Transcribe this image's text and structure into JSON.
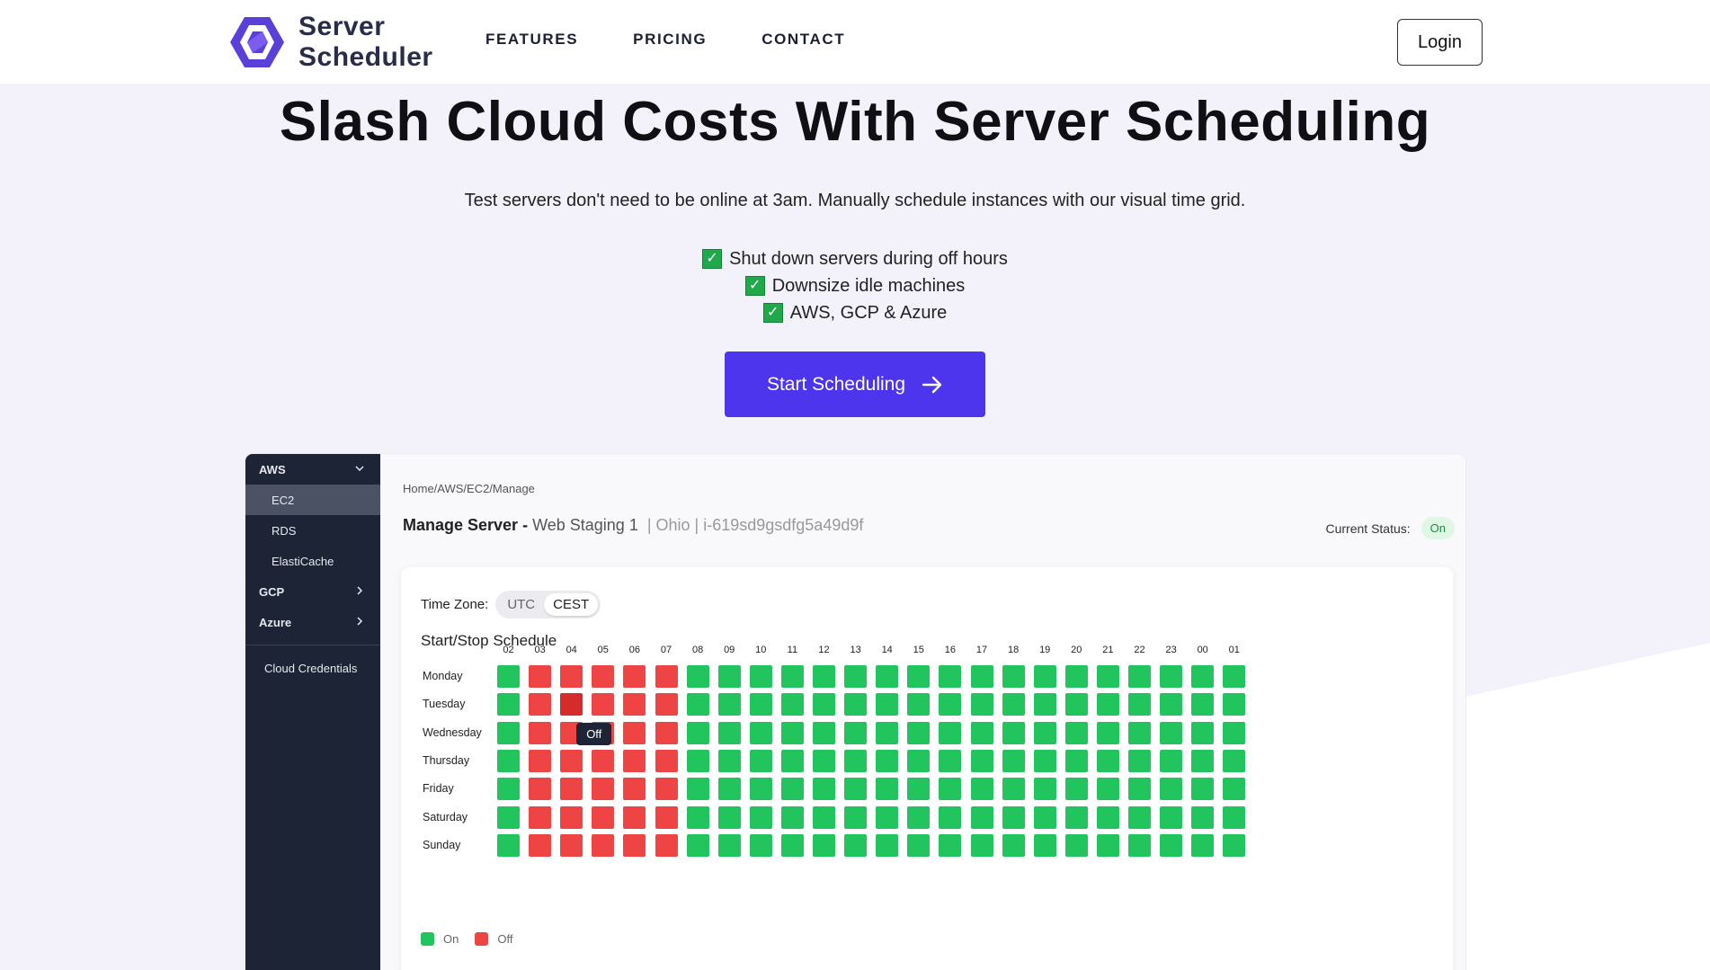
{
  "brand": {
    "name_line1": "Server",
    "name_line2": "Scheduler",
    "logo_color": "#5b3fd9"
  },
  "nav": {
    "links": [
      "FEATURES",
      "PRICING",
      "CONTACT"
    ],
    "login_label": "Login"
  },
  "hero": {
    "title": "Slash Cloud Costs With Server Scheduling",
    "subtitle": "Test servers don't need to be online at 3am. Manually schedule instances with our visual time grid.",
    "checks": [
      "Shut down servers during off hours",
      "Downsize idle machines",
      "AWS, GCP & Azure"
    ],
    "check_glyph": "✓",
    "cta_label": "Start Scheduling",
    "cta_color": "#4d35ee"
  },
  "app": {
    "sidebar": {
      "aws": "AWS",
      "aws_items": [
        "EC2",
        "RDS",
        "ElastiCache"
      ],
      "gcp": "GCP",
      "azure": "Azure",
      "credentials": "Cloud Credentials"
    },
    "breadcrumb": "Home/AWS/EC2/Manage",
    "manage_prefix": "Manage Server -",
    "server_name": "Web Staging 1",
    "server_meta": "| Ohio | i-619sd9gsdfg5a49d9f",
    "status_label": "Current Status:",
    "status_value": "On",
    "timezone_label": "Time Zone:",
    "timezone_options": [
      "UTC",
      "CEST"
    ],
    "timezone_selected": "CEST",
    "schedule_title": "Start/Stop Schedule",
    "hours": [
      "02",
      "03",
      "04",
      "05",
      "06",
      "07",
      "08",
      "09",
      "10",
      "11",
      "12",
      "13",
      "14",
      "15",
      "16",
      "17",
      "18",
      "19",
      "20",
      "21",
      "22",
      "23",
      "00",
      "01"
    ],
    "days": [
      "Monday",
      "Tuesday",
      "Wednesday",
      "Thursday",
      "Friday",
      "Saturday",
      "Sunday"
    ],
    "off_hours": [
      "03",
      "04",
      "05",
      "06",
      "07"
    ],
    "hover_cell": {
      "day": "Tuesday",
      "hour": "04"
    },
    "tooltip": {
      "text": "Off",
      "day": "Wednesday",
      "hour": "04"
    },
    "legend": {
      "on": "On",
      "off": "Off"
    },
    "colors": {
      "on": "#22c45e",
      "off": "#ef4444",
      "sidebar": "#1c2435"
    }
  }
}
